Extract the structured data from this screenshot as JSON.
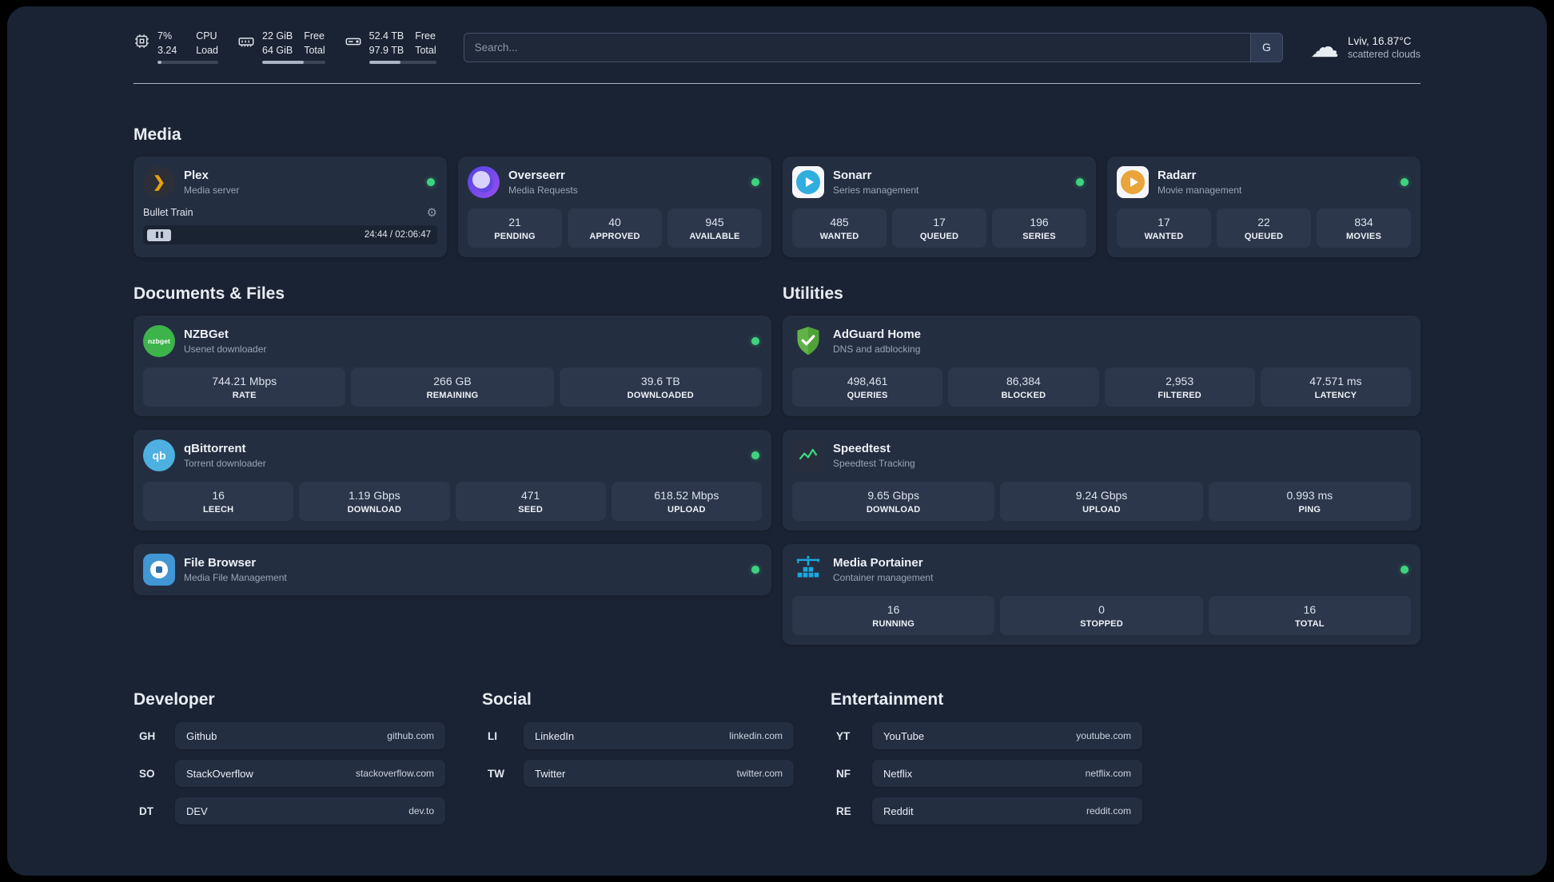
{
  "icons": {
    "gear": "⚙",
    "cloud": "☁",
    "plex_chevron": "❯",
    "nzbget_text": "nzbget",
    "qbittorrent_text": "qb"
  },
  "topbar": {
    "cpu": {
      "value_top": "7%",
      "value_bottom": "3.24",
      "label_top": "CPU",
      "label_bottom": "Load",
      "progress_pct": 7
    },
    "ram": {
      "value_top": "22 GiB",
      "value_bottom": "64 GiB",
      "label_top": "Free",
      "label_bottom": "Total",
      "progress_pct": 66
    },
    "disk": {
      "value_top": "52.4 TB",
      "value_bottom": "97.9 TB",
      "label_top": "Free",
      "label_bottom": "Total",
      "progress_pct": 47
    },
    "search": {
      "placeholder": "Search...",
      "button_label": "G"
    },
    "weather": {
      "line1": "Lviv, 16.87°C",
      "line2": "scattered clouds"
    }
  },
  "sections": {
    "media": "Media",
    "documents": "Documents & Files",
    "utilities": "Utilities"
  },
  "apps": {
    "plex": {
      "name": "Plex",
      "subtitle": "Media server",
      "player": {
        "track": "Bullet Train",
        "time": "24:44 / 02:06:47"
      }
    },
    "overseerr": {
      "name": "Overseerr",
      "subtitle": "Media Requests",
      "stats": [
        {
          "value": "21",
          "label": "PENDING"
        },
        {
          "value": "40",
          "label": "APPROVED"
        },
        {
          "value": "945",
          "label": "AVAILABLE"
        }
      ]
    },
    "sonarr": {
      "name": "Sonarr",
      "subtitle": "Series management",
      "stats": [
        {
          "value": "485",
          "label": "WANTED"
        },
        {
          "value": "17",
          "label": "QUEUED"
        },
        {
          "value": "196",
          "label": "SERIES"
        }
      ]
    },
    "radarr": {
      "name": "Radarr",
      "subtitle": "Movie management",
      "stats": [
        {
          "value": "17",
          "label": "WANTED"
        },
        {
          "value": "22",
          "label": "QUEUED"
        },
        {
          "value": "834",
          "label": "MOVIES"
        }
      ]
    },
    "nzbget": {
      "name": "NZBGet",
      "subtitle": "Usenet downloader",
      "stats": [
        {
          "value": "744.21 Mbps",
          "label": "RATE"
        },
        {
          "value": "266 GB",
          "label": "REMAINING"
        },
        {
          "value": "39.6 TB",
          "label": "DOWNLOADED"
        }
      ]
    },
    "qbittorrent": {
      "name": "qBittorrent",
      "subtitle": "Torrent downloader",
      "stats": [
        {
          "value": "16",
          "label": "LEECH"
        },
        {
          "value": "1.19 Gbps",
          "label": "DOWNLOAD"
        },
        {
          "value": "471",
          "label": "SEED"
        },
        {
          "value": "618.52 Mbps",
          "label": "UPLOAD"
        }
      ]
    },
    "filebrowser": {
      "name": "File Browser",
      "subtitle": "Media File Management"
    },
    "adguard": {
      "name": "AdGuard Home",
      "subtitle": "DNS and adblocking",
      "stats": [
        {
          "value": "498,461",
          "label": "QUERIES"
        },
        {
          "value": "86,384",
          "label": "BLOCKED"
        },
        {
          "value": "2,953",
          "label": "FILTERED"
        },
        {
          "value": "47.571 ms",
          "label": "LATENCY"
        }
      ]
    },
    "speedtest": {
      "name": "Speedtest",
      "subtitle": "Speedtest Tracking",
      "stats": [
        {
          "value": "9.65 Gbps",
          "label": "DOWNLOAD"
        },
        {
          "value": "9.24 Gbps",
          "label": "UPLOAD"
        },
        {
          "value": "0.993 ms",
          "label": "PING"
        }
      ]
    },
    "portainer": {
      "name": "Media Portainer",
      "subtitle": "Container management",
      "stats": [
        {
          "value": "16",
          "label": "RUNNING"
        },
        {
          "value": "0",
          "label": "STOPPED"
        },
        {
          "value": "16",
          "label": "TOTAL"
        }
      ]
    }
  },
  "bookmarks": {
    "developer": {
      "title": "Developer",
      "items": [
        {
          "abbr": "GH",
          "name": "Github",
          "domain": "github.com"
        },
        {
          "abbr": "SO",
          "name": "StackOverflow",
          "domain": "stackoverflow.com"
        },
        {
          "abbr": "DT",
          "name": "DEV",
          "domain": "dev.to"
        }
      ]
    },
    "social": {
      "title": "Social",
      "items": [
        {
          "abbr": "LI",
          "name": "LinkedIn",
          "domain": "linkedin.com"
        },
        {
          "abbr": "TW",
          "name": "Twitter",
          "domain": "twitter.com"
        }
      ]
    },
    "entertainment": {
      "title": "Entertainment",
      "items": [
        {
          "abbr": "YT",
          "name": "YouTube",
          "domain": "youtube.com"
        },
        {
          "abbr": "NF",
          "name": "Netflix",
          "domain": "netflix.com"
        },
        {
          "abbr": "RE",
          "name": "Reddit",
          "domain": "reddit.com"
        }
      ]
    }
  }
}
